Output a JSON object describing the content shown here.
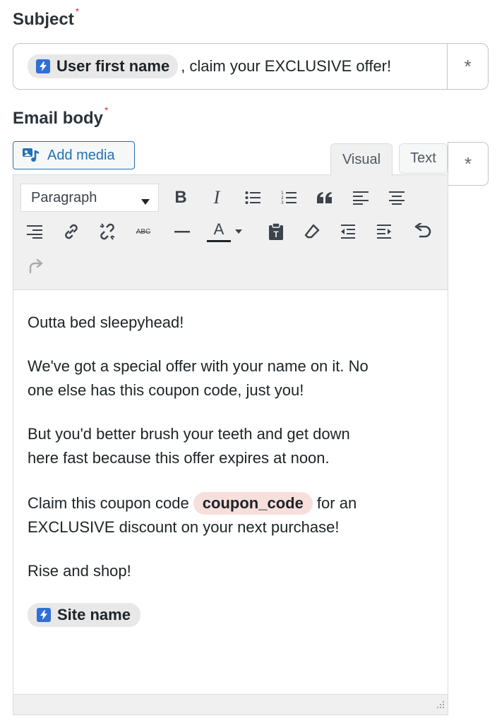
{
  "subject": {
    "label": "Subject",
    "required_mark": "*",
    "token_label": "User first name",
    "text_after_token": ", claim your EXCLUSIVE offer!",
    "asterisk_button": "*"
  },
  "email_body": {
    "label": "Email body",
    "required_mark": "*",
    "add_media_label": "Add media",
    "tabs": {
      "visual": "Visual",
      "text": "Text"
    },
    "asterisk_button": "*",
    "toolbar": {
      "format_value": "Paragraph",
      "buttons": [
        "bold",
        "italic",
        "bulleted-list",
        "numbered-list",
        "blockquote",
        "align-left",
        "align-center",
        "align-right",
        "insert-link",
        "remove-link",
        "strikethrough",
        "horizontal-line",
        "text-color",
        "paste-as-text",
        "clear-formatting",
        "outdent",
        "indent",
        "undo",
        "redo"
      ],
      "bold_glyph": "B",
      "italic_glyph": "I",
      "strike_glyph": "ABC",
      "color_glyph": "A"
    },
    "content": {
      "p1": "Outta bed sleepyhead!",
      "p2_line1": "We've got a special offer with your name on it. No",
      "p2_line2": "one else has this coupon code, just you!",
      "p3_line1": "But you'd better brush your teeth and get down",
      "p3_line2": "here fast because this offer expires at noon.",
      "p4_before": "Claim this coupon code ",
      "p4_code": "coupon_code",
      "p4_after": " for an",
      "p4_line2": "EXCLUSIVE discount on your next purchase!",
      "p5": "Rise and shop!",
      "site_token": "Site name"
    }
  },
  "colors": {
    "link_blue": "#2271b1",
    "token_bolt": "#2f6fd6",
    "code_pill": "#f7dfdc",
    "required": "#d63638"
  }
}
